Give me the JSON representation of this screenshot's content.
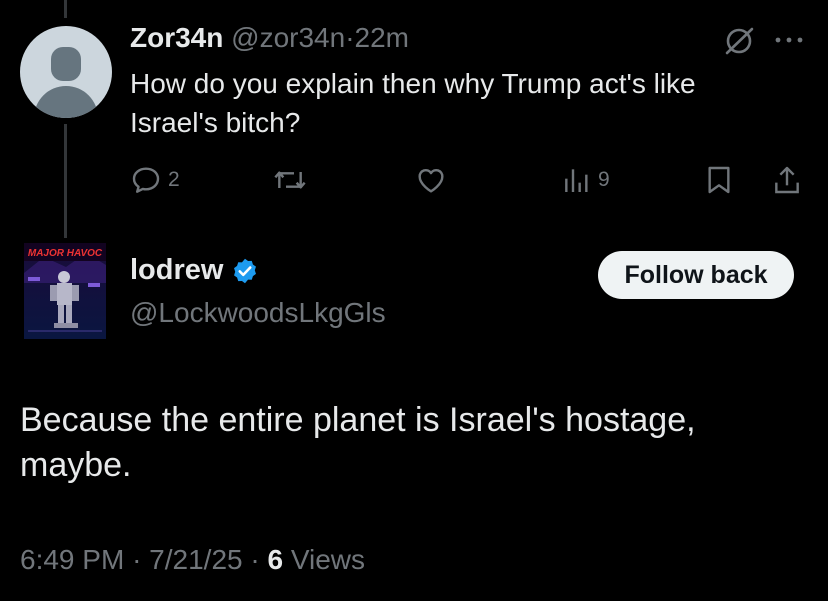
{
  "reply": {
    "name": "Zor34n",
    "handle": "@zor34n",
    "separator": "·",
    "time": "22m",
    "text": "How do you explain then why Trump act's like Israel's bitch?",
    "icons": [
      "grok-icon",
      "more-icon"
    ]
  },
  "reply_actions": {
    "reply_count": "2",
    "retweet_count": "",
    "like_count": "",
    "views_count": "9"
  },
  "author": {
    "name": "lodrew",
    "handle": "@LockwoodsLkgGls",
    "verified": true,
    "follow_label": "Follow back",
    "avatar_text": "MAJOR HAVOC"
  },
  "tweet": {
    "text": "Because the entire planet is Israel's hostage, maybe."
  },
  "meta": {
    "time": "6:49 PM",
    "sep1": "·",
    "date": "7/21/25",
    "sep2": "·",
    "views_count": "6",
    "views_label": "Views"
  },
  "colors": {
    "background": "#000000",
    "text": "#e7e9ea",
    "muted": "#71767b",
    "verified": "#1d9bf0",
    "button_bg": "#eff3f4",
    "thread_line": "#333639"
  }
}
